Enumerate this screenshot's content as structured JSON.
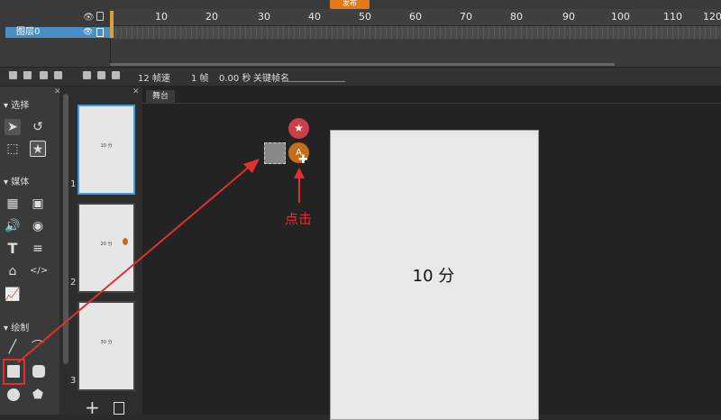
{
  "toolbar": {
    "publish_label": "发布"
  },
  "timeline": {
    "ruler": [
      "10",
      "20",
      "30",
      "40",
      "50",
      "60",
      "70",
      "80",
      "90",
      "100",
      "110",
      "120"
    ],
    "layer_name": "图层0",
    "fps": "12 帧速",
    "frame": "1 帧",
    "time": "0.00 秒",
    "keyframe_label": "关键帧名"
  },
  "tools": {
    "select": "选择",
    "media": "媒体",
    "draw": "绘制"
  },
  "thumbs": [
    {
      "num": "1",
      "text": "10 分",
      "active": true
    },
    {
      "num": "2",
      "text": "20 分",
      "active": false
    },
    {
      "num": "3",
      "text": "30 分",
      "active": false
    }
  ],
  "stage": {
    "tab": "舞台",
    "page_text": "10 分",
    "annotation": "点击"
  },
  "colors": {
    "accent": "#4a8ec3",
    "publish": "#e07a1a",
    "annotation": "#e03030",
    "red_circle": "#c9404a",
    "orange_circle": "#c46d1a"
  }
}
